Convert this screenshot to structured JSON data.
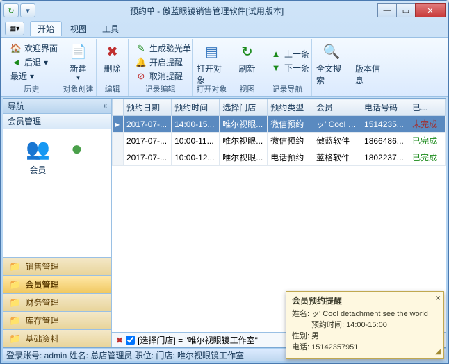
{
  "window": {
    "title": "预约单 - 傲蓝眼镜销售管理软件[试用版本]"
  },
  "tabs": {
    "start": "开始",
    "view": "视图",
    "tools": "工具"
  },
  "ribbon": {
    "history": {
      "welcome": "欢迎界面",
      "back": "后退",
      "recent": "最近",
      "label": "历史"
    },
    "create": {
      "new": "新建",
      "label": "对象创建"
    },
    "edit": {
      "delete": "删除",
      "label": "编辑"
    },
    "record": {
      "gen": "生成验光单",
      "remind": "开启提醒",
      "cancel": "取消提醒",
      "label": "记录编辑"
    },
    "open": {
      "btn": "打开对象",
      "label": "打开对象"
    },
    "viewg": {
      "refresh": "刷新",
      "label": "视图"
    },
    "nav": {
      "prev": "上一条",
      "next": "下一条",
      "label": "记录导航"
    },
    "search": {
      "btn": "全文搜索"
    },
    "ver": {
      "btn": "版本信息"
    }
  },
  "sidebar": {
    "header": "导航",
    "section": "会员管理",
    "members": "会员",
    "items": [
      "销售管理",
      "会员管理",
      "财务管理",
      "库存管理",
      "基础资料"
    ]
  },
  "grid": {
    "cols": [
      "预约日期",
      "预约时间",
      "选择门店",
      "预约类型",
      "会员",
      "电话号码",
      "已..."
    ],
    "rows": [
      {
        "d": "2017-07-...",
        "t": "14:00-15...",
        "s": "唯尔视眼...",
        "y": "微信预约",
        "m": "ッ' Cool d...",
        "p": "1514235...",
        "st": "未完成"
      },
      {
        "d": "2017-07-...",
        "t": "10:00-11...",
        "s": "唯尔视眼...",
        "y": "微信预约",
        "m": "傲蓝软件",
        "p": "1866486...",
        "st": "已完成"
      },
      {
        "d": "2017-07-...",
        "t": "10:00-12...",
        "s": "唯尔视眼...",
        "y": "电话预约",
        "m": "蓝格软件",
        "p": "1802237...",
        "st": "已完成"
      }
    ]
  },
  "filter": {
    "text": "[选择门店] = \"唯尔视眼镜工作室\""
  },
  "status": {
    "text": "登录账号: admin  姓名: 总店管理员  职位:   门店: 唯尔视眼镜工作室"
  },
  "popup": {
    "title": "会员预约提醒",
    "name_l": "姓名:",
    "name": "ッ' Cool detachment see the world",
    "time_l": "预约时间:",
    "time": "14:00-15:00",
    "sex_l": "性别:",
    "sex": "男",
    "tel_l": "电话:",
    "tel": "15142357951"
  }
}
